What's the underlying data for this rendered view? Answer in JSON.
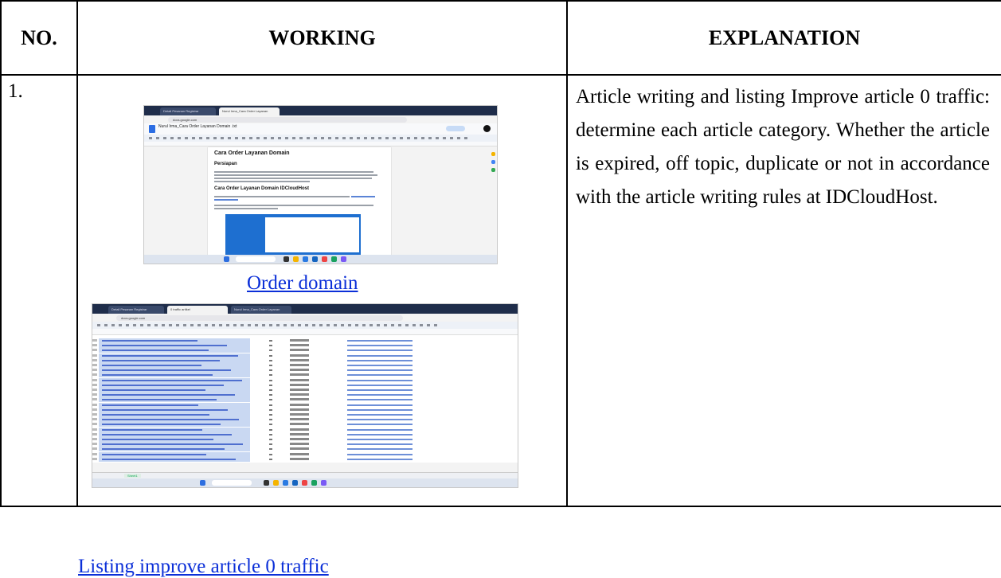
{
  "table": {
    "headers": {
      "no": "NO.",
      "working": "WORKING",
      "explanation": "EXPLANATION"
    },
    "rows": [
      {
        "no": "1.",
        "link1": "Order domain",
        "link2": "Listing improve article 0 traffic",
        "explanation": "Article writing and listing Improve article 0 traffic: determine each article category. Whether the article is expired, off topic, duplicate or not in accordance with the article writing rules at IDCloudHost."
      }
    ]
  },
  "screenshot1": {
    "tabs": [
      "Detail Pesanan Registrar",
      "Nurul Irma_Cara Order Layanan"
    ],
    "url": "docs.google.com",
    "doc_title": "Nurul Irma_Cara Order Layanan Domain .txt",
    "heading": "Cara Order Layanan Domain",
    "subheading1": "Persiapan",
    "subheading2": "Cara Order Layanan Domain IDCloudHost"
  },
  "screenshot2": {
    "tabs": [
      "Detail Pesanan Registrar",
      "0 traffic artikel",
      "Nurul Irma_Cara Order Layanan"
    ],
    "url": "docs.google.com",
    "sheet_tab": "Sheet1"
  },
  "colors": {
    "link": "#0b2fd8",
    "border": "#000000"
  }
}
